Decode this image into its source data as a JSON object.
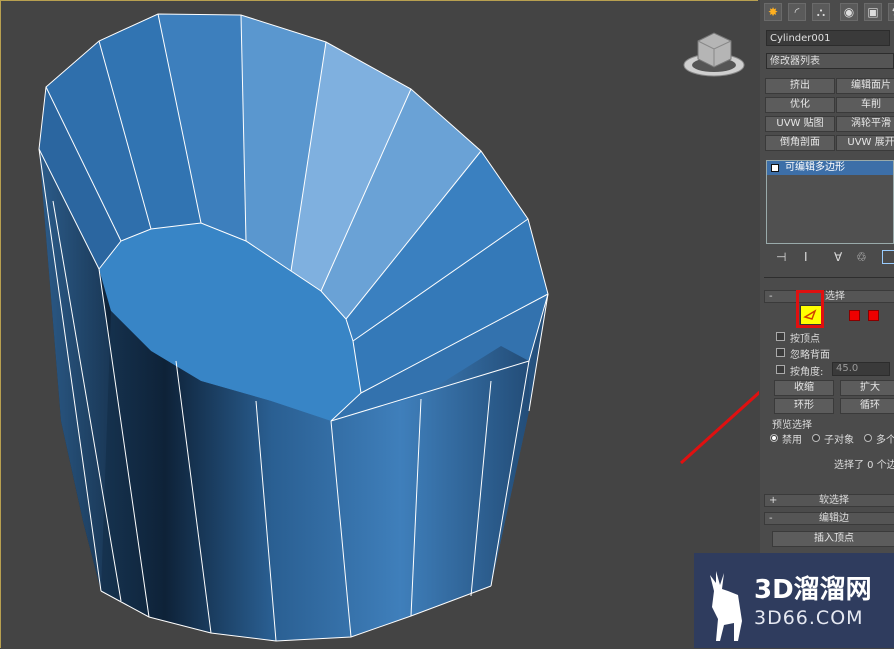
{
  "panel": {
    "object_name": "Cylinder001",
    "modifier_list": "修改器列表",
    "buttons": [
      "挤出",
      "编辑面片",
      "优化",
      "车削",
      "UVW 贴图",
      "涡轮平滑",
      "倒角剖面",
      "UVW 展开"
    ],
    "stack_item": "可编辑多边形",
    "selection_rollout": "选择",
    "by_vertex": "按顶点",
    "ignore_backfacing": "忽略背面",
    "by_angle": "按角度:",
    "angle_value": "45.0",
    "shrink": "收缩",
    "grow": "扩大",
    "ring": "环形",
    "loop": "循环",
    "preview_selection": "预览选择",
    "preview_options": [
      "禁用",
      "子对象",
      "多个"
    ],
    "selected_status": "选择了 0 个边",
    "soft_selection": "软选择",
    "edit_edges": "编辑边",
    "insert_vertex": "插入顶点",
    "rollout_minus": "-",
    "rollout_plus": "+"
  },
  "watermark": {
    "brand": "3D溜溜网",
    "url": "3D66.COM"
  },
  "colors": {
    "viewport_bg": "#444444",
    "mesh_blue": "#3a84c4",
    "highlight_red": "#e01010",
    "active_yellow": "#ffff00"
  }
}
